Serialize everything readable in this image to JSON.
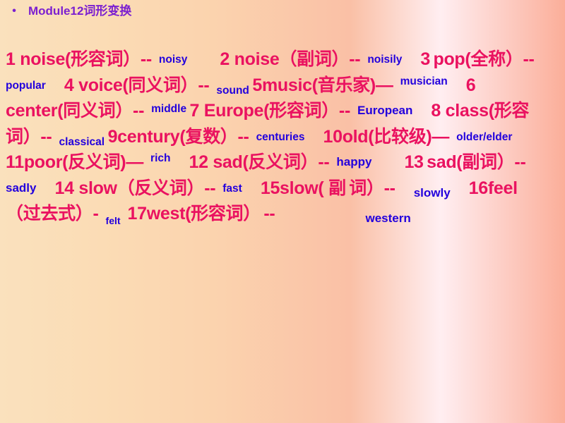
{
  "slide": {
    "background_left_color": "#fae1bd",
    "background_right_color": "#fbae99",
    "question_color": "#ea1260",
    "answer_color": "#2200dd",
    "title_color": "#7b1fd0",
    "bullet_glyph": "•"
  },
  "title": {
    "bullet": "•",
    "text": "Module12词形变换"
  },
  "body": {
    "bullet": "•",
    "runs": [
      {
        "id": "q1",
        "kind": "question",
        "text": "1 noise(形容词）--"
      },
      {
        "id": "a1",
        "kind": "answer",
        "text": "noisy"
      },
      {
        "id": "q2",
        "kind": "question",
        "text": "2 noise（副词）--"
      },
      {
        "id": "a2",
        "kind": "answer",
        "text": "noisily"
      },
      {
        "id": "q3",
        "kind": "question",
        "text": "3 pop(全称）--"
      },
      {
        "id": "a3",
        "kind": "answer",
        "text": "popular"
      },
      {
        "id": "q4",
        "kind": "question",
        "text": "4 voice(同义词）--"
      },
      {
        "id": "a4",
        "kind": "answer",
        "text": "sound"
      },
      {
        "id": "q5",
        "kind": "question",
        "text": "5music(音乐家)—"
      },
      {
        "id": "a5",
        "kind": "answer",
        "text": "musician"
      },
      {
        "id": "q6",
        "kind": "question",
        "text": "6 center(同义词）--"
      },
      {
        "id": "a6",
        "kind": "answer",
        "text": "middle"
      },
      {
        "id": "q7",
        "kind": "question",
        "text": "7 Europe(形容词）--"
      },
      {
        "id": "a7",
        "kind": "answer",
        "text": "European"
      },
      {
        "id": "q8",
        "kind": "question",
        "text": "8 class(形容词）--"
      },
      {
        "id": "a8",
        "kind": "answer",
        "text": "classical"
      },
      {
        "id": "q9",
        "kind": "question",
        "text": "9century(复数）--"
      },
      {
        "id": "a9",
        "kind": "answer",
        "text": "centuries"
      },
      {
        "id": "q10",
        "kind": "question",
        "text": "10old(比较级)—"
      },
      {
        "id": "a10",
        "kind": "answer",
        "text": "older/elder"
      },
      {
        "id": "q11",
        "kind": "question",
        "text": "11poor(反义词)—"
      },
      {
        "id": "a11",
        "kind": "answer",
        "text": "rich"
      },
      {
        "id": "q12",
        "kind": "question",
        "text": "12 sad(反义词）--"
      },
      {
        "id": "a12",
        "kind": "answer",
        "text": "happy"
      },
      {
        "id": "q13",
        "kind": "question",
        "text": "13 sad(副词）--"
      },
      {
        "id": "a13",
        "kind": "answer",
        "text": "sadly"
      },
      {
        "id": "q14",
        "kind": "question",
        "text": "14 slow（反义词）--"
      },
      {
        "id": "a14",
        "kind": "answer",
        "text": "fast"
      },
      {
        "id": "q15",
        "kind": "question",
        "text": "15slow( 副词）--"
      },
      {
        "id": "a15",
        "kind": "answer",
        "text": "slowly"
      },
      {
        "id": "q16",
        "kind": "question",
        "text": "16feel（过去式）-"
      },
      {
        "id": "a16",
        "kind": "answer",
        "text": "felt"
      },
      {
        "id": "q17",
        "kind": "question",
        "text": "17west(形容词）--"
      },
      {
        "id": "a17",
        "kind": "answer",
        "text": "western"
      }
    ],
    "fragments": {
      "q1": "1 noise(形容词）--",
      "q2": "2 noise（副词）--",
      "q3_num": "3",
      "q3_rest": "pop(全称）--",
      "q4": "4 voice(同义词）--",
      "q5": "5music(音乐家)—",
      "q6": "6 center(同义词）--",
      "q7": "7 Europe(形容词）--",
      "q8": "8 class(形容词）--",
      "q9": "9century(复数）--",
      "q10": "10old(比较级)—",
      "q11": "11poor(反义词)—",
      "q12": "12 sad(反义词）--",
      "q13_num": "13",
      "q13_rest": "sad(副词）--",
      "q14": "14 slow（反义词）--",
      "q15_head": "15slow( 副",
      "q15_tail": "词）--",
      "q16": "16feel（过去式）-",
      "q17_head": "17west(形容词）",
      "q17_tail": "--",
      "a1": "noisy",
      "a2": "noisily",
      "a3": "popular",
      "a4": "sound",
      "a5": "musician",
      "a6": "middle",
      "a7": "European",
      "a8": "classical",
      "a9": "centuries",
      "a10": "older/elder",
      "a11": "rich",
      "a12": "happy",
      "a13": "sadly",
      "a14": "fast",
      "a15": "slowly",
      "a16": "felt",
      "a17": "western"
    }
  }
}
